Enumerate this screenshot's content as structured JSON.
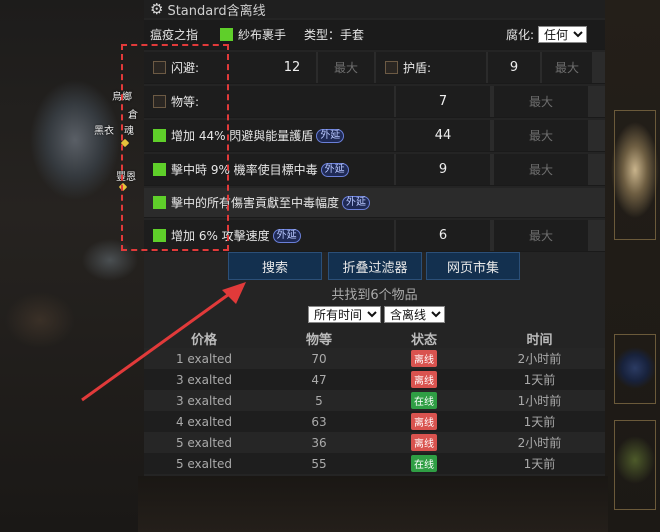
{
  "background": {
    "map_markers": [
      "烏鄉",
      "倉",
      "黑衣",
      "魂",
      "豐恩"
    ]
  },
  "panel": {
    "title": "Standard含离线",
    "header_row": {
      "item_name": "瘟疫之指",
      "base_type": "紗布裹手",
      "category": "类型：手套",
      "corrupted_label": "腐化:",
      "corrupted_value": "任何",
      "corrupted_options": [
        "任何"
      ]
    },
    "stat_rows": [
      {
        "label": "闪避:",
        "checked": false,
        "value": "12",
        "max_placeholder": "最大",
        "extra_label": "护盾:",
        "extra_checked": false,
        "extra_value": "9",
        "extra_max_placeholder": "最大"
      },
      {
        "label": "物等:",
        "checked": false,
        "value": "7",
        "max_placeholder": "最大"
      }
    ],
    "mod_rows": [
      {
        "text": "增加 44% 閃避與能量護盾",
        "tag": "外延",
        "checked": true,
        "value": "44",
        "max_placeholder": "最大"
      },
      {
        "text": "擊中時 9% 機率使目標中毒",
        "tag": "外延",
        "checked": true,
        "value": "9",
        "max_placeholder": "最大"
      },
      {
        "text": "擊中的所有傷害貢獻至中毒幅度",
        "tag": "外延",
        "checked": true,
        "value": "",
        "max_placeholder": ""
      },
      {
        "text": "增加 6% 攻擊速度",
        "tag": "外延",
        "checked": true,
        "value": "6",
        "max_placeholder": "最大"
      }
    ],
    "buttons": {
      "search": "搜索",
      "collapse": "折叠过滤器",
      "web_market": "网页市集"
    },
    "found_text": "共找到6个物品",
    "time_filter": "所有时间",
    "time_filter_options": [
      "所有时间"
    ],
    "online_filter": "含离线",
    "online_filter_options": [
      "含离线"
    ],
    "results": {
      "headers": [
        "价格",
        "物等",
        "状态",
        "时间"
      ],
      "rows": [
        {
          "price": "1 exalted",
          "ilvl": "70",
          "status": "离线",
          "online": false,
          "time": "2小时前"
        },
        {
          "price": "3 exalted",
          "ilvl": "47",
          "status": "离线",
          "online": false,
          "time": "1天前"
        },
        {
          "price": "3 exalted",
          "ilvl": "5",
          "status": "在线",
          "online": true,
          "time": "1小时前"
        },
        {
          "price": "4 exalted",
          "ilvl": "63",
          "status": "离线",
          "online": false,
          "time": "1天前"
        },
        {
          "price": "5 exalted",
          "ilvl": "36",
          "status": "离线",
          "online": false,
          "time": "2小时前"
        },
        {
          "price": "5 exalted",
          "ilvl": "55",
          "status": "在线",
          "online": true,
          "time": "1天前"
        }
      ]
    }
  },
  "colors": {
    "check_on": "#5fcf2a",
    "status_offline": "#d9534f",
    "status_online": "#2f9e44",
    "annotation": "#e13a3a",
    "button_bg": "#13304f"
  }
}
